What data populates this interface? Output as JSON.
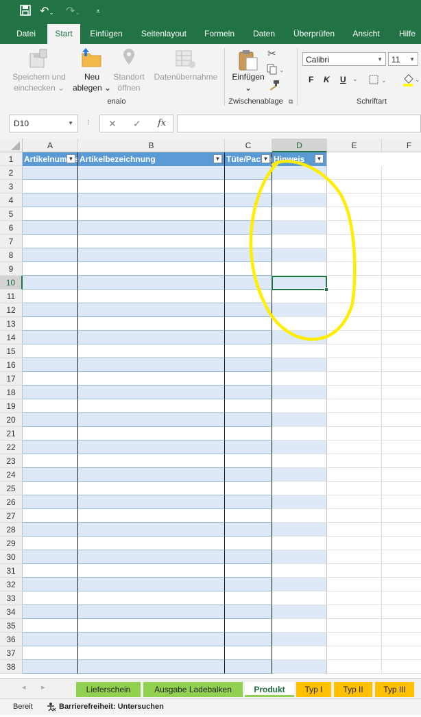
{
  "quick_access": {
    "save_icon": "save-icon",
    "undo_icon": "undo-icon",
    "redo_icon": "redo-icon",
    "customize_icon": "customize-icon"
  },
  "ribbon_tabs": [
    "Datei",
    "Start",
    "Einfügen",
    "Seitenlayout",
    "Formeln",
    "Daten",
    "Überprüfen",
    "Ansicht",
    "Hilfe"
  ],
  "active_tab": "Start",
  "ribbon": {
    "save_check_line1": "Speichern und",
    "save_check_line2": "einchecken",
    "new_line1": "Neu",
    "new_line2": "ablegen",
    "location_line1": "Standort",
    "location_line2": "öffnen",
    "data_import": "Datenübernahme",
    "group_enaio": "enaio",
    "paste": "Einfügen",
    "group_clipboard": "Zwischenablage",
    "font_name": "Calibri",
    "font_size": "11",
    "bold": "F",
    "italic": "K",
    "underline": "U",
    "group_font": "Schriftart"
  },
  "formula_bar": {
    "name_box": "D10",
    "cancel": "✕",
    "enter": "✓",
    "fx": "fx",
    "content": ""
  },
  "grid": {
    "columns": [
      "A",
      "B",
      "C",
      "D",
      "E",
      "F"
    ],
    "selected_column": "D",
    "rows": [
      1,
      2,
      3,
      4,
      5,
      6,
      7,
      8,
      9,
      10,
      11,
      12,
      13,
      14,
      15,
      16,
      17,
      18,
      19,
      20,
      21,
      22,
      23,
      24,
      25,
      26,
      27,
      28,
      29,
      30,
      31,
      32,
      33,
      34,
      35,
      36,
      37,
      38
    ],
    "selected_row": 10,
    "table_headers": [
      "Artikelnummer",
      "Artikelbezeichnung",
      "Tüte/Packung",
      "Hinweis"
    ],
    "active_cell": "D10"
  },
  "annotation": {
    "color": "#ffee00",
    "shape": "freehand-ellipse"
  },
  "sheet_tabs": [
    {
      "label": "Lieferschein",
      "color": "#92d050",
      "active": false
    },
    {
      "label": "Ausgabe Ladebalken",
      "color": "#92d050",
      "active": false
    },
    {
      "label": "Produkt",
      "color": "#92d050",
      "active": true
    },
    {
      "label": "Typ I",
      "color": "#ffc000",
      "active": false
    },
    {
      "label": "Typ II",
      "color": "#ffc000",
      "active": false
    },
    {
      "label": "Typ III",
      "color": "#ffc000",
      "active": false
    }
  ],
  "status_bar": {
    "ready": "Bereit",
    "accessibility": "Barrierefreiheit: Untersuchen"
  },
  "colors": {
    "excel_green": "#217346",
    "table_header": "#5b9bd5",
    "band": "#dde9f6"
  }
}
